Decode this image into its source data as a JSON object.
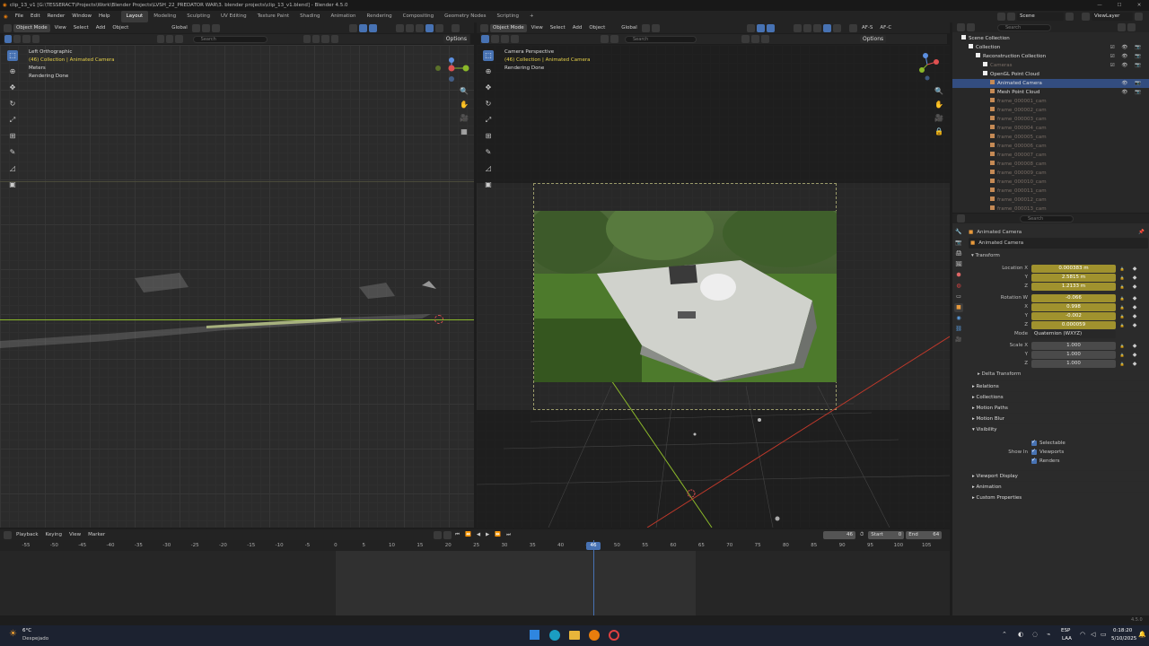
{
  "titlebar": {
    "title": "clip_13_v1 [G:\\TESSERACT\\Projects\\Work\\Blender Projects\\LVSH_22_PREDATOR WAR\\3. blender projects\\clip_13_v1.blend] - Blender 4.5.0",
    "min": "—",
    "max": "☐",
    "close": "✕"
  },
  "menubar": {
    "menus": [
      "File",
      "Edit",
      "Render",
      "Window",
      "Help"
    ],
    "workspaces": [
      "Layout",
      "Modeling",
      "Sculpting",
      "UV Editing",
      "Texture Paint",
      "Shading",
      "Animation",
      "Rendering",
      "Compositing",
      "Geometry Nodes",
      "Scripting"
    ],
    "add_ws": "+",
    "scene": "Scene",
    "viewlayer": "ViewLayer"
  },
  "left_vp": {
    "header": {
      "mode": "Object Mode",
      "view": "View",
      "select": "Select",
      "add": "Add",
      "object": "Object",
      "orient": "Global",
      "options": "Options",
      "search_ph": "Search"
    },
    "overlay": {
      "view_name": "Left Orthographic",
      "collection": "(46) Collection | Animated Camera",
      "units": "Meters",
      "status": "Rendering Done"
    }
  },
  "right_vp": {
    "header": {
      "mode": "Object Mode",
      "view": "View",
      "select": "Select",
      "add": "Add",
      "object": "Object",
      "orient": "Global",
      "af_s": "AF-S",
      "af_c": "AF-C",
      "options": "Options",
      "search_ph": "Search"
    },
    "overlay": {
      "view_name": "Camera Perspective",
      "collection": "(46) Collection | Animated Camera",
      "status": "Rendering Done"
    }
  },
  "outliner": {
    "search_ph": "Search",
    "rows": [
      {
        "label": "Scene Collection",
        "indent": 0,
        "dim": false,
        "icons": ""
      },
      {
        "label": "Collection",
        "indent": 1,
        "dim": false,
        "icons": "☑ 👁 📷"
      },
      {
        "label": "Reconstruction Collection",
        "indent": 2,
        "dim": false,
        "icons": "☑ 👁 📷"
      },
      {
        "label": "Cameras",
        "indent": 3,
        "dim": true,
        "icons": "☑ 👁 📷"
      },
      {
        "label": "OpenGL Point Cloud",
        "indent": 3,
        "dim": false,
        "icons": ""
      },
      {
        "label": "Animated Camera",
        "indent": 4,
        "dim": false,
        "icons": "👁 📷"
      },
      {
        "label": "Mesh Point Cloud",
        "indent": 4,
        "dim": false,
        "icons": "👁 📷"
      },
      {
        "label": "frame_000001_cam",
        "indent": 4,
        "dim": true,
        "icons": ""
      },
      {
        "label": "frame_000002_cam",
        "indent": 4,
        "dim": true,
        "icons": ""
      },
      {
        "label": "frame_000003_cam",
        "indent": 4,
        "dim": true,
        "icons": ""
      },
      {
        "label": "frame_000004_cam",
        "indent": 4,
        "dim": true,
        "icons": ""
      },
      {
        "label": "frame_000005_cam",
        "indent": 4,
        "dim": true,
        "icons": ""
      },
      {
        "label": "frame_000006_cam",
        "indent": 4,
        "dim": true,
        "icons": ""
      },
      {
        "label": "frame_000007_cam",
        "indent": 4,
        "dim": true,
        "icons": ""
      },
      {
        "label": "frame_000008_cam",
        "indent": 4,
        "dim": true,
        "icons": ""
      },
      {
        "label": "frame_000009_cam",
        "indent": 4,
        "dim": true,
        "icons": ""
      },
      {
        "label": "frame_000010_cam",
        "indent": 4,
        "dim": true,
        "icons": ""
      },
      {
        "label": "frame_000011_cam",
        "indent": 4,
        "dim": true,
        "icons": ""
      },
      {
        "label": "frame_000012_cam",
        "indent": 4,
        "dim": true,
        "icons": ""
      },
      {
        "label": "frame_000013_cam",
        "indent": 4,
        "dim": true,
        "icons": ""
      }
    ]
  },
  "properties": {
    "search_ph": "Search",
    "object_breadcrumb": "Animated Camera",
    "object_name": "Animated Camera",
    "transform_label": "Transform",
    "location": [
      {
        "label": "Location X",
        "value": "0.000383 m"
      },
      {
        "label": "Y",
        "value": "2.5815 m"
      },
      {
        "label": "Z",
        "value": "1.2133 m"
      }
    ],
    "rotation": [
      {
        "label": "Rotation W",
        "value": "-0.066"
      },
      {
        "label": "X",
        "value": "0.998"
      },
      {
        "label": "Y",
        "value": "-0.002"
      },
      {
        "label": "Z",
        "value": "0.000059"
      }
    ],
    "mode_label": "Mode",
    "mode_value": "Quaternion (WXYZ)",
    "scale": [
      {
        "label": "Scale X",
        "value": "1.000"
      },
      {
        "label": "Y",
        "value": "1.000"
      },
      {
        "label": "Z",
        "value": "1.000"
      }
    ],
    "delta_transform": "Delta Transform",
    "panels1": [
      "Relations",
      "Collections",
      "Motion Paths",
      "Motion Blur"
    ],
    "visibility": "Visibility",
    "selectable": "Selectable",
    "show_in": "Show In",
    "viewports": "Viewports",
    "renders": "Renders",
    "panels2": [
      "Viewport Display",
      "Animation",
      "Custom Properties"
    ]
  },
  "timeline": {
    "menus": [
      "Playback",
      "Keying",
      "View",
      "Marker"
    ],
    "current_frame": "46",
    "start_label": "Start",
    "start": "0",
    "end_label": "End",
    "end": "64",
    "ticks": [
      "-55",
      "-50",
      "-45",
      "-40",
      "-35",
      "-30",
      "-25",
      "-20",
      "-15",
      "-10",
      "-5",
      "0",
      "5",
      "10",
      "15",
      "20",
      "25",
      "30",
      "35",
      "40",
      "45",
      "50",
      "55",
      "60",
      "65",
      "70",
      "75",
      "80",
      "85",
      "90",
      "95",
      "100",
      "105"
    ],
    "playhead": "46"
  },
  "version": "4.5.0",
  "taskbar": {
    "temp": "6°C",
    "weather": "Despejado",
    "lang1": "ESP",
    "lang2": "LAA",
    "time": "0:18:20",
    "date": "5/10/2025"
  }
}
